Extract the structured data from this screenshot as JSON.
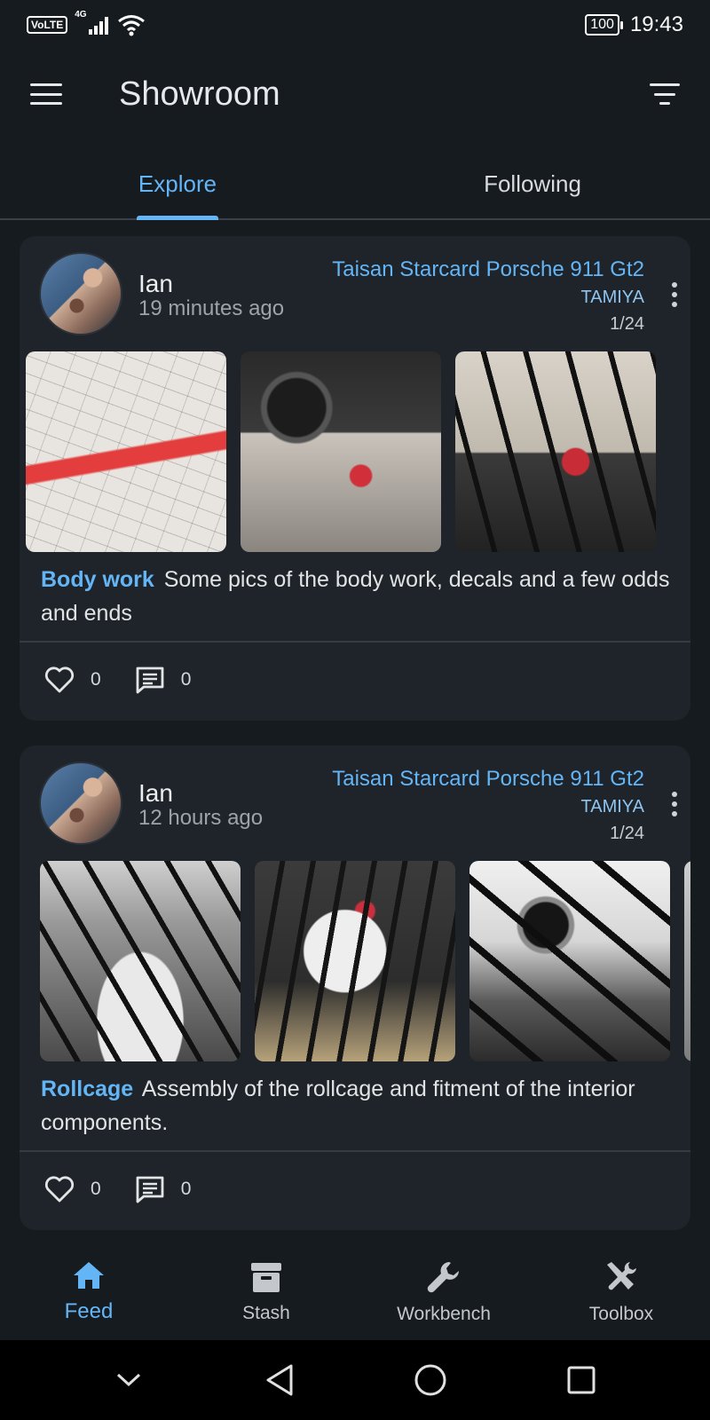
{
  "status_bar": {
    "volte": "VoLTE",
    "network": "4G",
    "battery": "100",
    "time": "19:43"
  },
  "app_bar": {
    "title": "Showroom"
  },
  "tabs": [
    {
      "label": "Explore",
      "active": true
    },
    {
      "label": "Following",
      "active": false
    }
  ],
  "posts": [
    {
      "user": "Ian",
      "time": "19 minutes ago",
      "kit_name": "Taisan Starcard Porsche 911 Gt2",
      "brand": "TAMIYA",
      "scale": "1/24",
      "tag": "Body work",
      "text": "Some pics of the body work, decals and a few odds and ends",
      "likes": "0",
      "comments": "0"
    },
    {
      "user": "Ian",
      "time": "12 hours ago",
      "kit_name": "Taisan Starcard Porsche 911 Gt2",
      "brand": "TAMIYA",
      "scale": "1/24",
      "tag": "Rollcage",
      "text": "Assembly of the rollcage and fitment of the interior components.",
      "likes": "0",
      "comments": "0"
    }
  ],
  "bottom_nav": [
    {
      "label": "Feed",
      "icon": "home-icon",
      "active": true
    },
    {
      "label": "Stash",
      "icon": "archive-box-icon",
      "active": false
    },
    {
      "label": "Workbench",
      "icon": "wrench-icon",
      "active": false
    },
    {
      "label": "Toolbox",
      "icon": "tools-icon",
      "active": false
    }
  ],
  "colors": {
    "background": "#161b20",
    "card": "#1e2429",
    "accent": "#64b5f6"
  }
}
